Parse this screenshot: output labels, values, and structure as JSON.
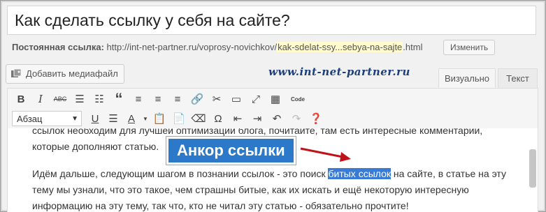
{
  "title": "Как сделать ссылку у себя на сайте?",
  "permalink": {
    "label": "Постоянная ссылка:",
    "base": "http://int-net-partner.ru/voprosy-novichkov/",
    "slug": "kak-sdelat-ssy...sebya-na-sajte",
    "ext": ".html",
    "change_button": "Изменить"
  },
  "media_button": "Добавить медиафайл",
  "watermark": "www.int-net-partner.ru",
  "tabs": {
    "visual": "Визуально",
    "text": "Текст"
  },
  "toolbar": {
    "format_select": "Абзац",
    "code_label": "Code"
  },
  "content": {
    "line1_partial": "ссылок необходим для лучшей оптимизации блога, почитайте, там есть интересные комментарии,",
    "line2": "которые дополняют статью.",
    "para2_before": "Идём дальше, следующим шагом в познании ссылок - это поиск ",
    "para2_highlight": "битых ссылок",
    "para2_after": " на сайте, в статье на эту тему мы узнали, что это такое, чем страшны битые, как их искать и ещё некоторую интересную информацию на эту тему, так что, кто не читал эту статью - обязательно прочтите!"
  },
  "callout": "Анкор ссылки",
  "colors": {
    "callout_bg": "#2c79c9",
    "arrow": "#c0121a",
    "highlight": "#3a7bd5",
    "slug_bg": "#fffbcc"
  },
  "icons": [
    "bold",
    "italic",
    "strikethrough",
    "bulleted-list",
    "numbered-list",
    "blockquote",
    "align-left",
    "align-center",
    "align-right",
    "link",
    "unlink",
    "more-tag",
    "fullscreen",
    "toolbar-toggle",
    "code",
    "underline",
    "justify",
    "text-color",
    "paste-text",
    "paste-word",
    "clear-formatting",
    "special-char",
    "indent",
    "outdent",
    "undo",
    "redo",
    "help"
  ]
}
